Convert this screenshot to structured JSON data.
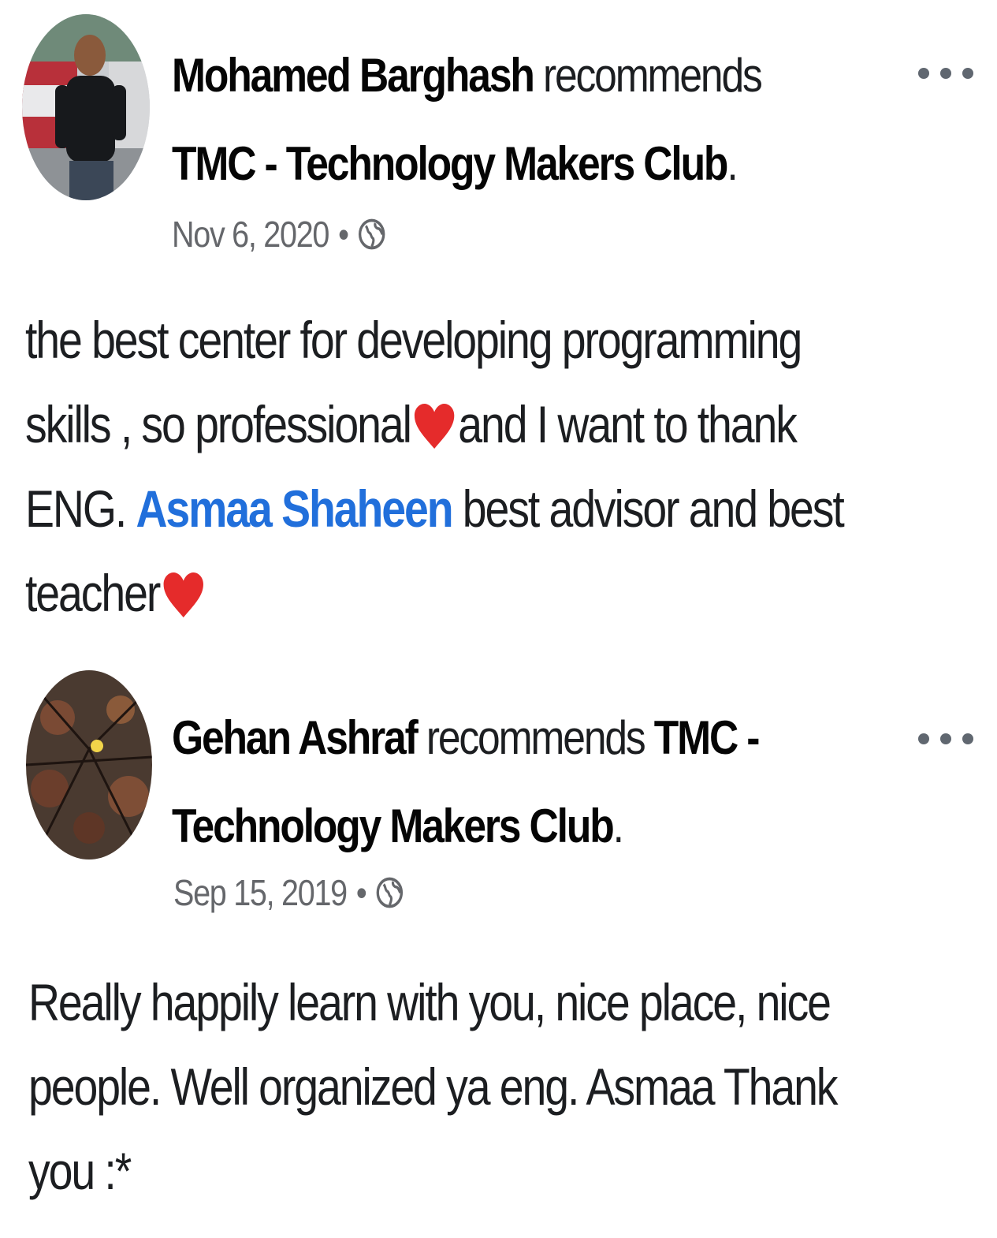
{
  "colors": {
    "author": "#050505",
    "text": "#1c1e21",
    "meta": "#65676b",
    "mention": "#216fdb",
    "heart": "#e52b2b",
    "more_dots": "#606770"
  },
  "posts": [
    {
      "author": "Mohamed Barghash",
      "verb": "recommends",
      "page": "TMC - Technology Makers Club",
      "page_suffix": ".",
      "date": "Nov 6, 2020",
      "separator": "•",
      "audience_icon": "globe-icon",
      "more_icon": "more-horizontal-icon",
      "body": {
        "part1": "the best center for developing programming skills , so professional",
        "part2": "and I want to thank ENG.",
        "mention": "Asmaa Shaheen",
        "part3": "best advisor and best teacher",
        "emoji": "heart-icon"
      }
    },
    {
      "author": "Gehan Ashraf",
      "verb": "recommends",
      "page": "TMC - Technology Makers Club",
      "page_suffix": ".",
      "date": "Sep 15, 2019",
      "separator": "•",
      "audience_icon": "globe-icon",
      "more_icon": "more-horizontal-icon",
      "body": {
        "text": "Really happily learn with you, nice place, nice people. Well organized ya eng. Asmaa Thank you :*"
      }
    }
  ]
}
